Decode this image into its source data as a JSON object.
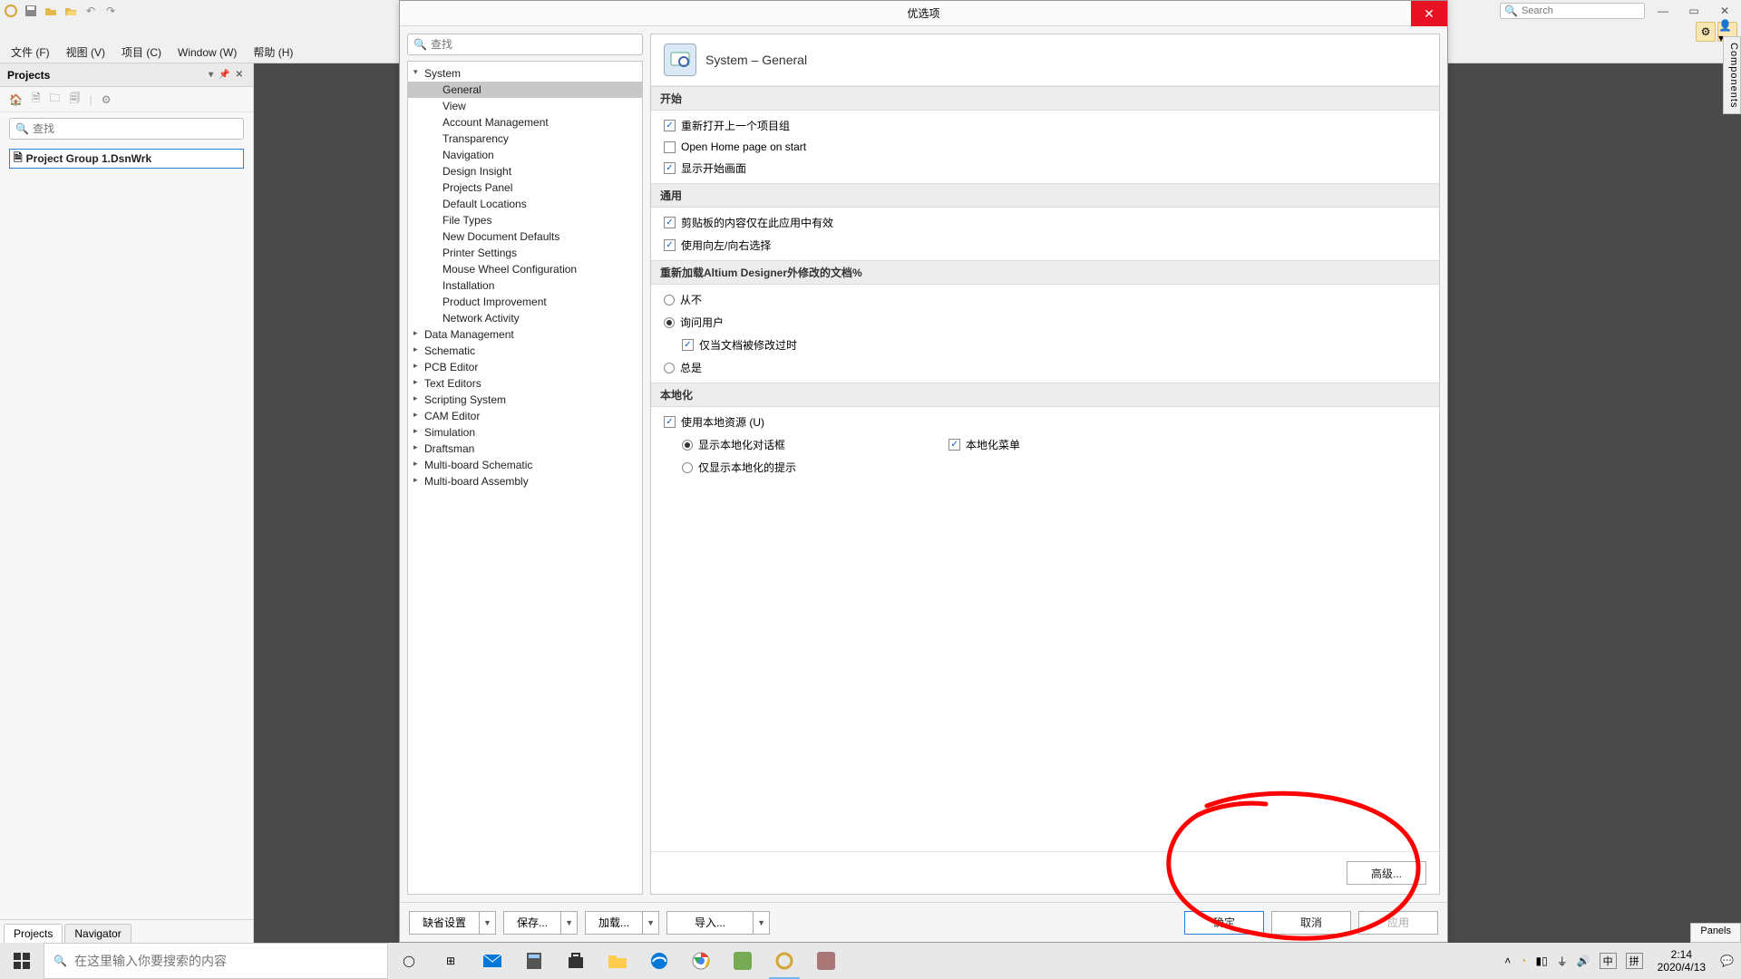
{
  "app": {
    "search_placeholder": "Search",
    "menus": [
      "文件 (F)",
      "视图 (V)",
      "项目 (C)",
      "Window (W)",
      "帮助 (H)"
    ]
  },
  "projects": {
    "title": "Projects",
    "search_placeholder": "查找",
    "group": "Project Group 1.DsnWrk",
    "tabs": [
      "Projects",
      "Navigator"
    ]
  },
  "side_tab": "Components",
  "panels_label": "Panels",
  "dialog": {
    "title": "优选项",
    "search_placeholder": "查找",
    "tree": {
      "system": {
        "label": "System",
        "children": [
          "General",
          "View",
          "Account Management",
          "Transparency",
          "Navigation",
          "Design Insight",
          "Projects Panel",
          "Default Locations",
          "File Types",
          "New Document Defaults",
          "Printer Settings",
          "Mouse Wheel Configuration",
          "Installation",
          "Product Improvement",
          "Network Activity"
        ],
        "selected": "General"
      },
      "rest": [
        "Data Management",
        "Schematic",
        "PCB Editor",
        "Text Editors",
        "Scripting System",
        "CAM Editor",
        "Simulation",
        "Draftsman",
        "Multi-board Schematic",
        "Multi-board Assembly"
      ]
    },
    "content": {
      "title": "System – General",
      "groups": {
        "start": {
          "header": "开始",
          "reopen": "重新打开上一个项目组",
          "openhome": "Open Home page on start",
          "splash": "显示开始画面"
        },
        "general": {
          "header": "通用",
          "clipboard": "剪贴板的内容仅在此应用中有效",
          "leftright": "使用向左/向右选择"
        },
        "reload": {
          "header": "重新加载Altium Designer外修改的文档%",
          "never": "从不",
          "ask": "询问用户",
          "only_modified": "仅当文档被修改过时",
          "always": "总是"
        },
        "local": {
          "header": "本地化",
          "use_local": "使用本地资源 (U)",
          "show_dlg": "显示本地化对话框",
          "local_menu": "本地化菜单",
          "only_hint": "仅显示本地化的提示"
        }
      },
      "advanced": "高级..."
    },
    "footer": {
      "defaults": "缺省设置",
      "save": "保存...",
      "load": "加载...",
      "import": "导入...",
      "ok": "确定",
      "cancel": "取消",
      "apply": "应用"
    }
  },
  "taskbar": {
    "search_placeholder": "在这里输入你要搜索的内容",
    "ime1": "中",
    "ime2": "拼",
    "time": "2:14",
    "date": "2020/4/13"
  }
}
